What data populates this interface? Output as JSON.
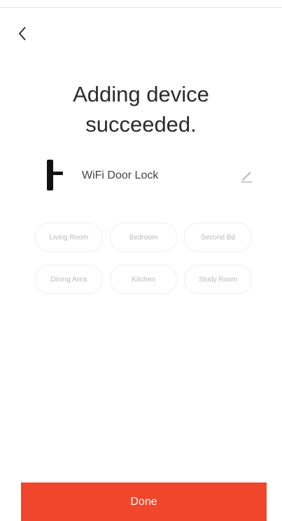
{
  "header": {
    "back_icon": "chevron-left-icon"
  },
  "title": "Adding device\nsucceeded.",
  "device": {
    "icon": "door-lock-icon",
    "name": "WiFi Door Lock",
    "edit_icon": "pencil-icon"
  },
  "rooms": [
    {
      "label": "Living Room"
    },
    {
      "label": "Bedroom"
    },
    {
      "label": "Second Bd"
    },
    {
      "label": "Dining Area"
    },
    {
      "label": "Kitchen"
    },
    {
      "label": "Study Room"
    }
  ],
  "footer": {
    "done_label": "Done"
  },
  "colors": {
    "accent": "#f0462b"
  }
}
